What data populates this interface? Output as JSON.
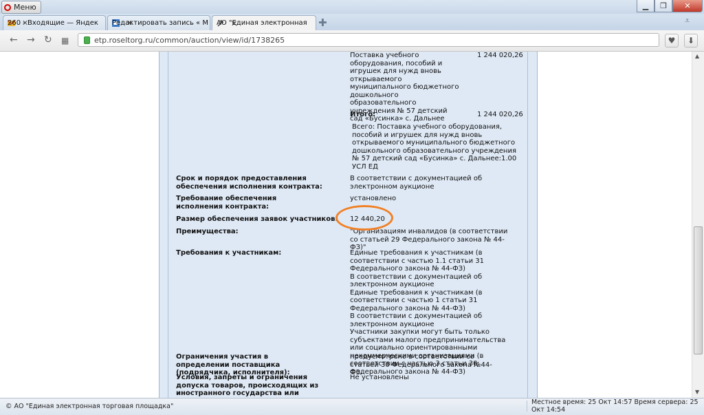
{
  "browser": {
    "menu_label": "Меню",
    "tabs": [
      {
        "label": "260 - Входящие — Яндек",
        "close": "✕"
      },
      {
        "label": "Редактировать запись « М",
        "close": "✕"
      },
      {
        "label": "АО \"Единая электронная",
        "close": "✕"
      }
    ],
    "url": "etp.roseltorg.ru/common/auction/view/id/1738265"
  },
  "page": {
    "lot_item_text": "Поставка учебного оборудования, пособий и игрушек для нужд вновь открываемого муниципального бюджетного дошкольного образовательного учреждения № 57 детский сад «Бусинка» с. Дальнее",
    "lot_item_amount": "1 244 020,26",
    "total_label": "Итого:",
    "total_amount": "1 244 020,26",
    "total_desc": "Всего: Поставка учебного оборудования, пособий и игрушек для нужд вновь открываемого муниципального бюджетного дошкольного образовательного учреждения № 57 детский сад «Бусинка» с. Дальнее:1.00 УСЛ ЕД",
    "rows": [
      {
        "label": "Срок и порядок предоставления обеспечения исполнения контракта:",
        "value": "В соответствии с документацией об электронном аукционе"
      },
      {
        "label": "Требование обеспечения исполнения контракта:",
        "value": "установлено"
      },
      {
        "label": "Размер обеспечения заявок участников:",
        "value": "12 440,20"
      },
      {
        "label": "Преимущества:",
        "value": "\"Организациям инвалидов (в соответствии со статьей 29 Федерального закона № 44-ФЗ)\""
      },
      {
        "label": "Требования к участникам:",
        "value": "Единые требования к участникам (в соответствии с частью 1.1 статьи 31 Федерального закона № 44-ФЗ)\nВ соответствии с документацией об электронном аукционе\nЕдиные требования к участникам (в соответствии с частью 1 статьи 31 Федерального закона № 44-ФЗ)\nВ соответствии с документацией об электронном аукционе\nУчастники закупки могут быть только субъектами малого предпринимательства или социально ориентированными некоммерческими организациями (в соответствии с частью 3 статьи 30 Федерального закона № 44-ФЗ)"
      },
      {
        "label": "Ограничения участия в определении поставщика (подрядчика, исполнителя):",
        "value": "предусмотрено в соответствии со статьей 30 Федерального закона №44-ФЗ."
      },
      {
        "label": "Условия, запреты и ограничения допуска товаров, происходящих из иностранного государства или группы иностранных",
        "value": "Не установлены"
      }
    ]
  },
  "status": {
    "left": "© АО \"Единая электронная торговая площадка\"",
    "right": "Местное время: 25 Окт 14:57 Время сервера: 25 Окт 14:54"
  }
}
